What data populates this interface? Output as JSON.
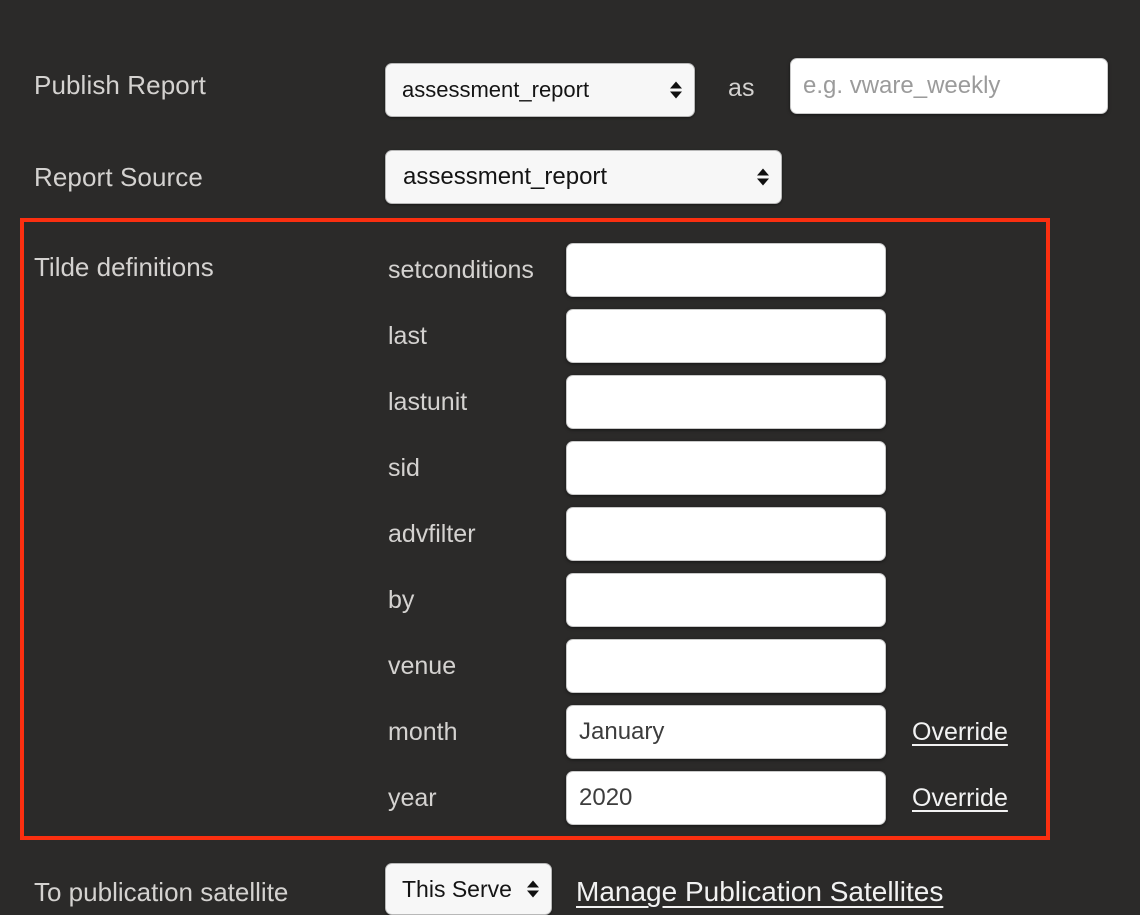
{
  "theme": {
    "background": "#2b2a29",
    "highlight_border": "#fb2f10",
    "label_color": "#d4d2d0",
    "input_background": "#ffffff",
    "link_color": "#f2f2f2"
  },
  "publish_report": {
    "label": "Publish Report",
    "source_select": {
      "value": "assessment_report",
      "options": [
        "assessment_report"
      ]
    },
    "as_label": "as",
    "name_input": {
      "value": "",
      "placeholder": "e.g. vware_weekly"
    }
  },
  "report_source": {
    "label": "Report Source",
    "select": {
      "value": "assessment_report",
      "options": [
        "assessment_report"
      ]
    }
  },
  "tilde_definitions": {
    "label": "Tilde definitions",
    "rows": [
      {
        "name": "setconditions",
        "value": "",
        "override_label": null
      },
      {
        "name": "last",
        "value": "",
        "override_label": null
      },
      {
        "name": "lastunit",
        "value": "",
        "override_label": null
      },
      {
        "name": "sid",
        "value": "",
        "override_label": null
      },
      {
        "name": "advfilter",
        "value": "",
        "override_label": null
      },
      {
        "name": "by",
        "value": "",
        "override_label": null
      },
      {
        "name": "venue",
        "value": "",
        "override_label": null
      },
      {
        "name": "month",
        "value": "January",
        "override_label": "Override"
      },
      {
        "name": "year",
        "value": "2020",
        "override_label": "Override"
      }
    ]
  },
  "publication_satellite": {
    "label": "To publication satellite",
    "select": {
      "value": "This Server",
      "options": [
        "This Server"
      ]
    },
    "manage_link": "Manage Publication Satellites"
  }
}
